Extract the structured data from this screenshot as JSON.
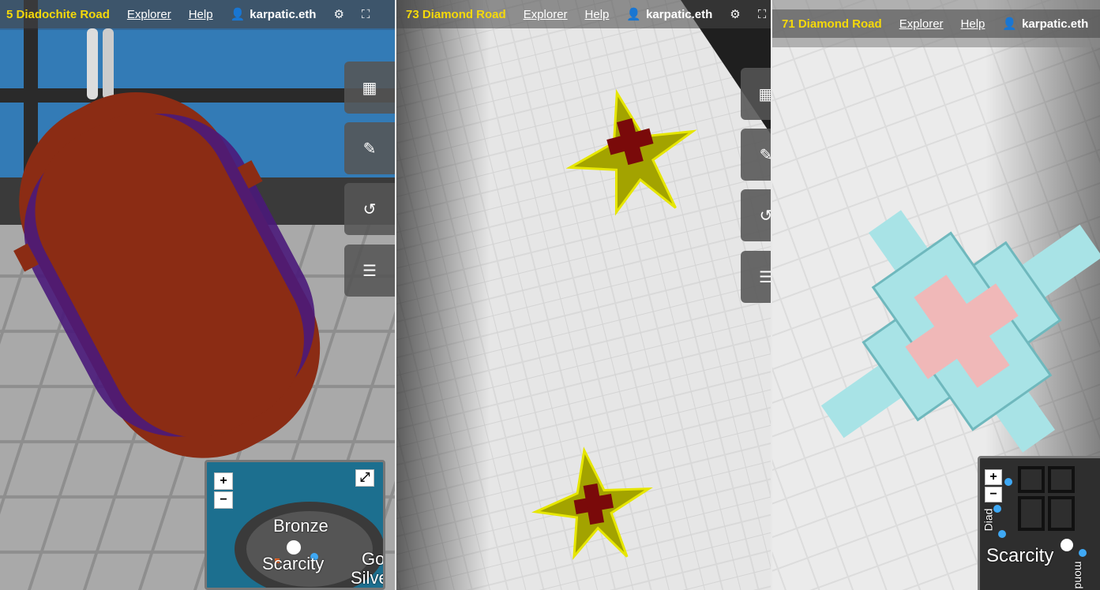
{
  "panels": [
    {
      "parcel": "5 Diadochite Road",
      "menu": [
        "Explorer",
        "Help"
      ],
      "user": "karpatic.eth",
      "minimap": {
        "labels": [
          "Bronze",
          "Scarcity",
          "Go",
          "Silve"
        ]
      }
    },
    {
      "parcel": "73 Diamond Road",
      "menu": [
        "Explorer",
        "Help"
      ],
      "user": "karpatic.eth"
    },
    {
      "parcel": "71 Diamond Road",
      "menu": [
        "Explorer",
        "Help"
      ],
      "user": "karpatic.eth",
      "minimap": {
        "labels": [
          "Scarcity",
          "Diad",
          "mond"
        ]
      }
    }
  ],
  "icons": {
    "user": "user-icon",
    "settings": "sliders-icon",
    "fullscreen": "expand-icon",
    "cubes": "cubes-icon",
    "brush": "brush-icon",
    "history": "history-icon",
    "list": "list-icon"
  },
  "zoom": {
    "in": "+",
    "out": "−"
  },
  "colors": {
    "parcel_title": "#f5d90a",
    "orb_red": "#8b2c14",
    "orb_purple": "#4a1a7a",
    "star_yellow": "#a3a300",
    "star_red": "#7a0a0a",
    "cross_cyan": "#a8e3e6",
    "cross_pink": "#f0b8b8"
  }
}
